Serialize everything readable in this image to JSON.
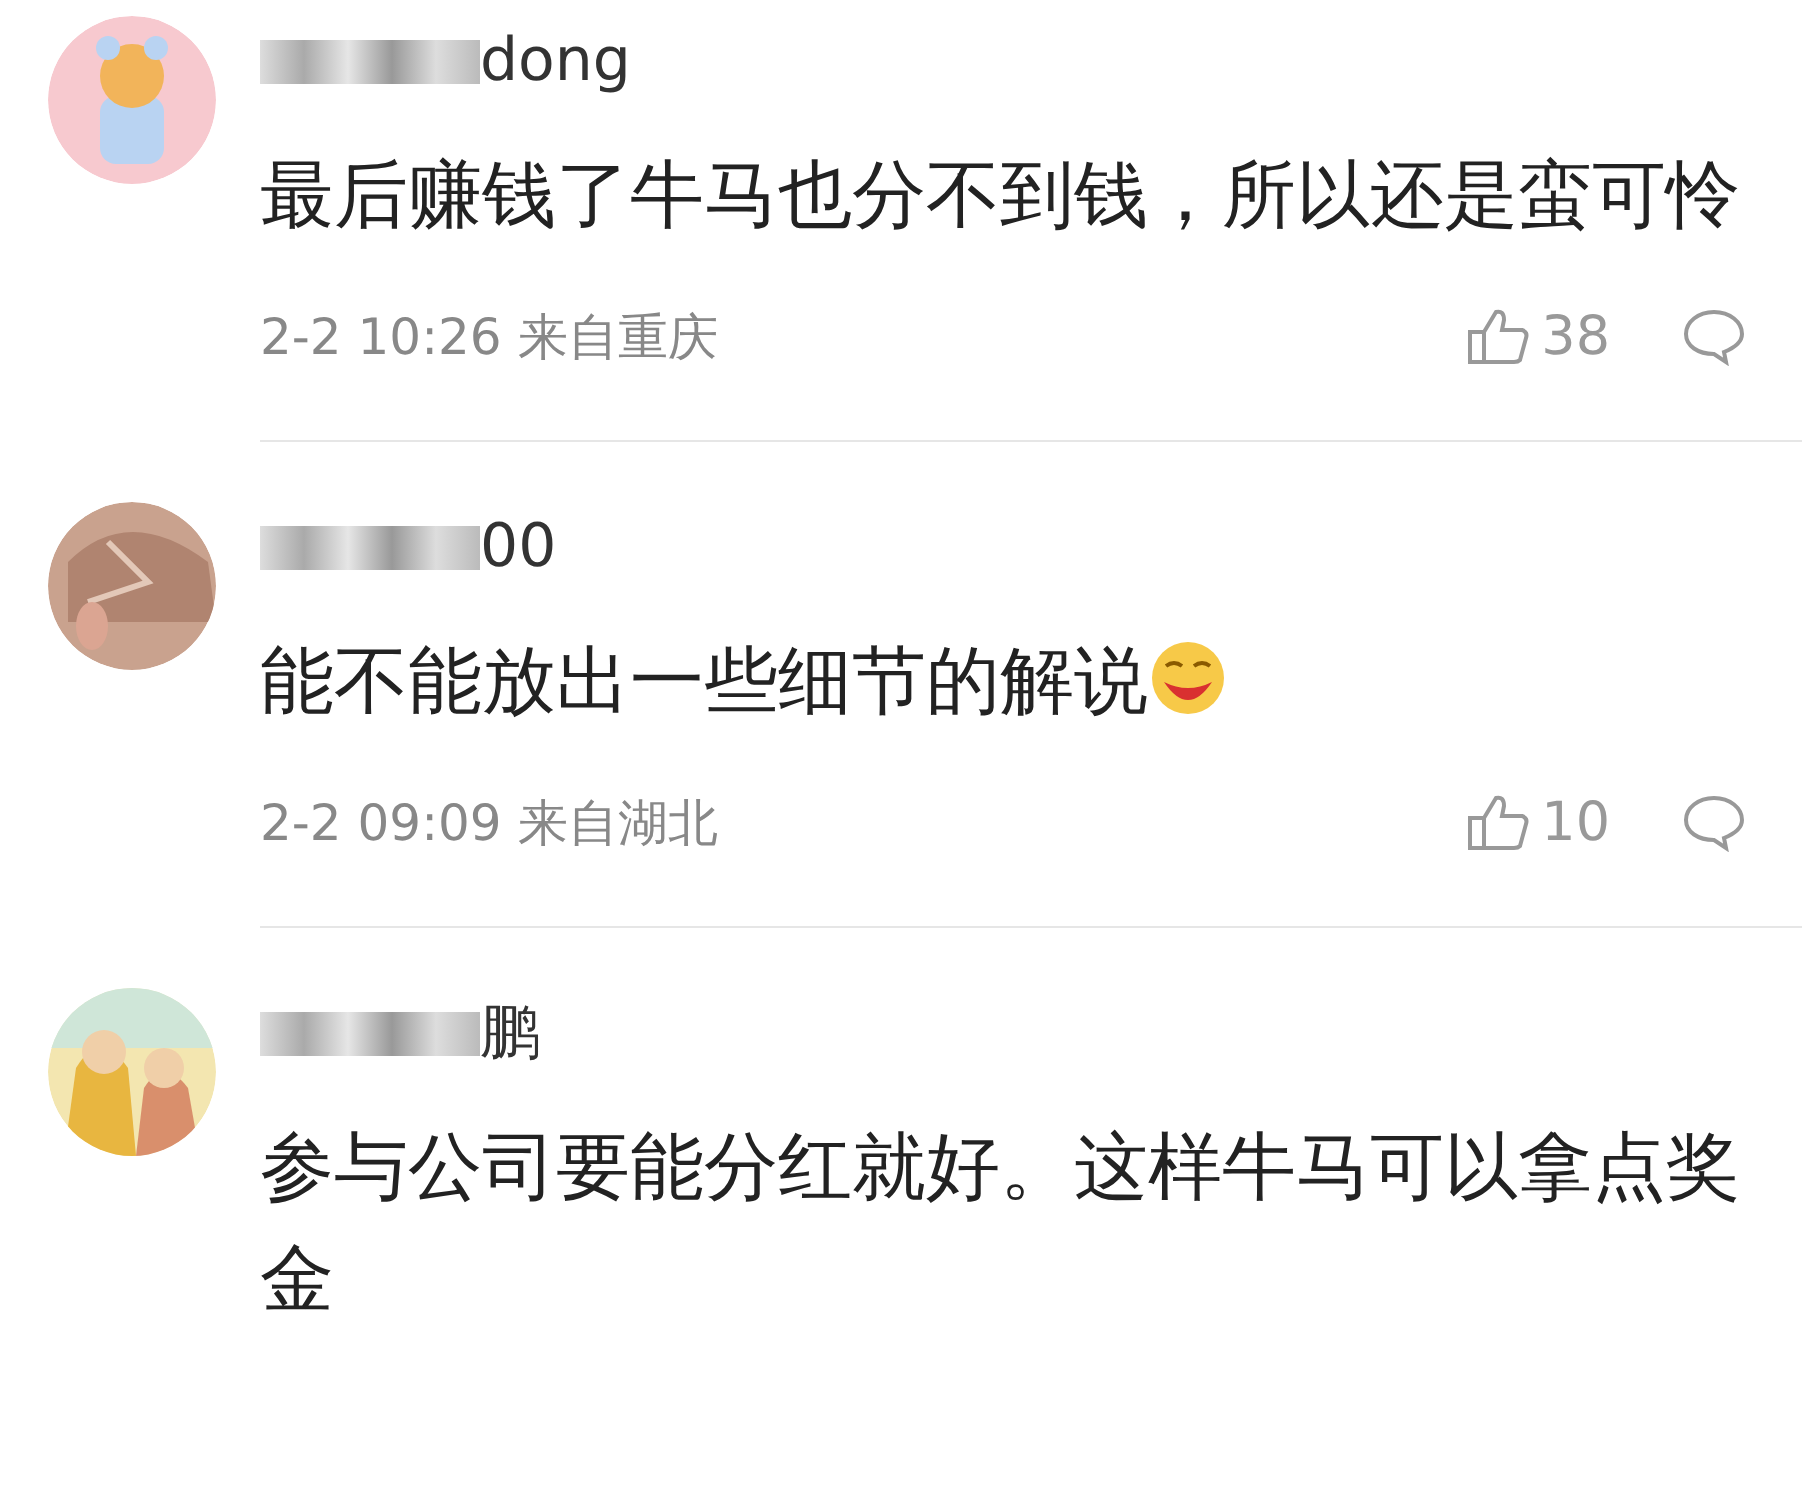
{
  "comments": [
    {
      "username": "dong",
      "username_masked": true,
      "text": "最后赚钱了牛马也分不到钱，所以还是蛮可怜",
      "emoji": false,
      "time": "2-2 10:26",
      "location": "来自重庆",
      "likes": "38"
    },
    {
      "username": "00",
      "username_masked": true,
      "text": "能不能放出一些细节的解说",
      "emoji": true,
      "time": "2-2 09:09",
      "location": "来自湖北",
      "likes": "10"
    },
    {
      "username": "鹏",
      "username_masked": true,
      "text": "参与公司要能分红就好。这样牛马可以拿点奖金",
      "emoji": false
    }
  ]
}
